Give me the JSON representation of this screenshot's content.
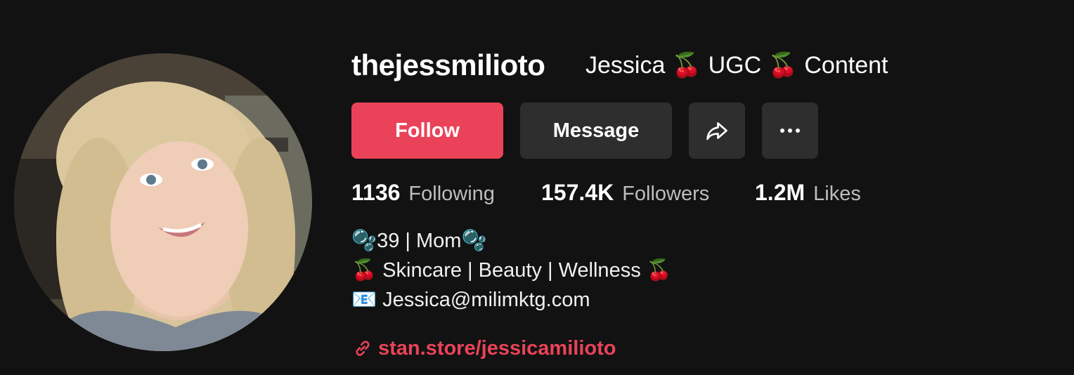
{
  "profile": {
    "username": "thejessmilioto",
    "nickname": "Jessica 🍒 UGC 🍒 Content",
    "avatar_icon": "profile-photo"
  },
  "actions": {
    "follow_label": "Follow",
    "message_label": "Message",
    "share_icon": "share-arrow-icon",
    "more_icon": "more-dots-icon"
  },
  "stats": {
    "following_count": "1136",
    "following_label": "Following",
    "followers_count": "157.4K",
    "followers_label": "Followers",
    "likes_count": "1.2M",
    "likes_label": "Likes"
  },
  "bio": {
    "line1": "🫧39 | Mom🫧",
    "line2": "🍒 Skincare | Beauty | Wellness 🍒",
    "line3": "📧 Jessica@milimktg.com"
  },
  "link": {
    "icon": "link-icon",
    "text": "stan.store/jessicamilioto"
  },
  "colors": {
    "background": "#121212",
    "accent": "#ea4359",
    "button_secondary": "#2e2e2e",
    "muted_text": "#bdbdbd"
  }
}
